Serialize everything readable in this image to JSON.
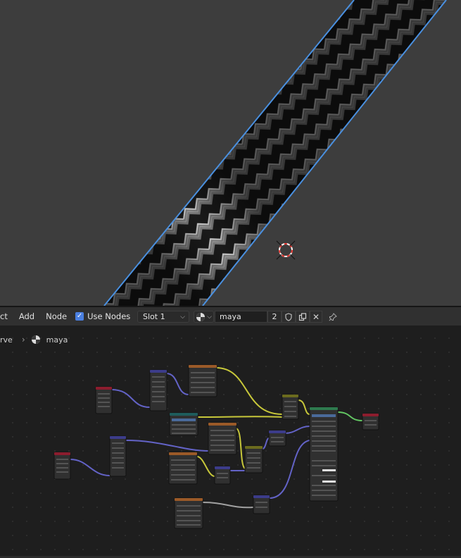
{
  "header": {
    "menu": [
      "ct",
      "Add",
      "Node"
    ],
    "use_nodes_label": "Use Nodes",
    "use_nodes_checked": true,
    "slot_label": "Slot 1",
    "material_name": "maya",
    "user_count": "2"
  },
  "breadcrumb": {
    "object": "rve",
    "material": "maya"
  },
  "colors": {
    "accent": "#4a7fe0",
    "viewport_bg": "#3d3d3d",
    "editor_bg": "#1e1e1e",
    "outline": "#4a90e0",
    "wire_yellow": "#c7c73a",
    "wire_purple": "#6363c7",
    "wire_gray": "#a1a1a1",
    "wire_green": "#63c763"
  },
  "icons": [
    "chevron-right-icon",
    "material-sphere-icon",
    "shield-icon",
    "duplicate-icon",
    "close-icon",
    "pin-icon",
    "cursor-3d-icon",
    "checkmark-icon"
  ]
}
